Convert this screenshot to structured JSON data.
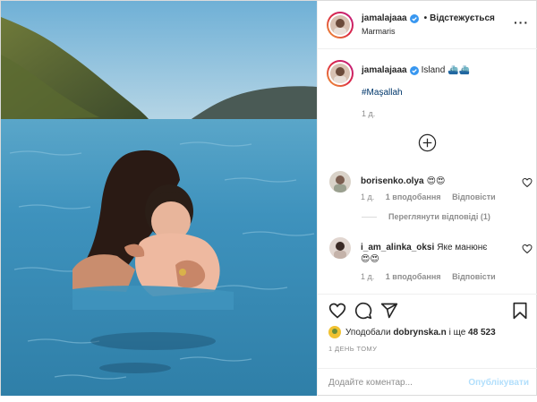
{
  "post": {
    "author": {
      "username": "jamalajaaa",
      "verified": true,
      "follow_state": "Відстежується",
      "location": "Marmaris"
    },
    "caption": {
      "text": "Island ⛴️⛴️",
      "hashtag": "#Maşallah",
      "time": "1 д."
    },
    "load_more_icon": "plus-circle-icon",
    "comments": [
      {
        "username": "borisenko.olya",
        "text": "😍😍",
        "time": "1 д.",
        "likes": "1 вподобання",
        "reply_label": "Відповісти",
        "view_replies": "Переглянути відповіді (1)"
      },
      {
        "username": "i_am_alinka_oksi",
        "text": "Яке манюнє😍😍",
        "time": "1 д.",
        "likes": "1 вподобання",
        "reply_label": "Відповісти"
      }
    ],
    "actions": {
      "icons": [
        "heart-icon",
        "comment-icon",
        "share-icon",
        "bookmark-icon"
      ],
      "liked_by_prefix": "Уподобали",
      "liked_by_user": "dobrynska.n",
      "liked_by_and": "і ще",
      "liked_by_count": "48 523",
      "time": "1 ДЕНЬ ТОМУ"
    },
    "comment_input": {
      "placeholder": "Додайте коментар...",
      "publish_label": "Опублікувати"
    }
  },
  "colors": {
    "link": "#00376b",
    "muted": "#8e8e8e",
    "publish_disabled": "#b2dffc",
    "sea": "#3e8fb4",
    "sky": "#9fc6dc"
  }
}
